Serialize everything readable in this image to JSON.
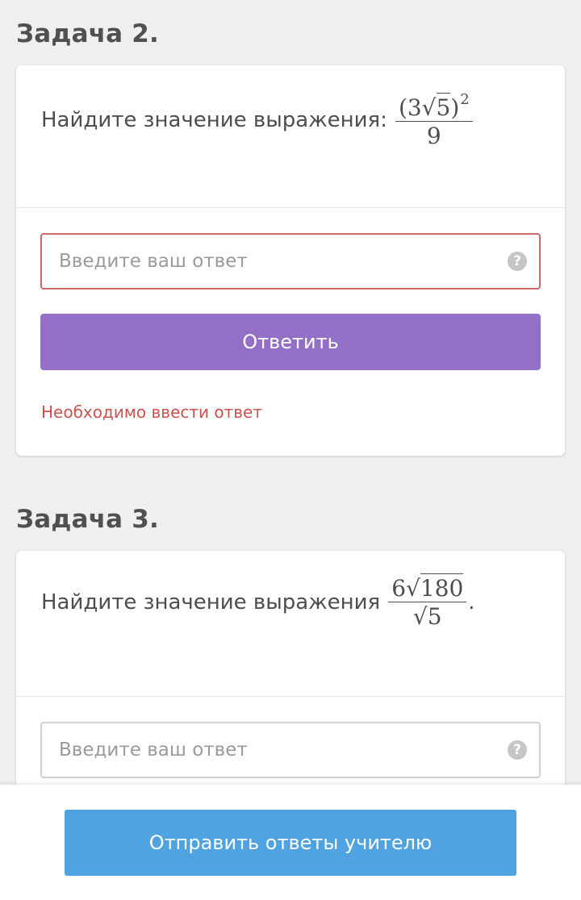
{
  "task2": {
    "title": "Задача 2.",
    "question_text": "Найдите значение выражения:",
    "expr": {
      "num_open": "(3√",
      "num_radicand": "5",
      "num_close": ")",
      "num_power": "2",
      "den": "9"
    },
    "answer_placeholder": "Введите ваш ответ",
    "help_icon": "?",
    "submit_label": "Ответить",
    "error_text": "Необходимо ввести ответ"
  },
  "task3": {
    "title": "Задача 3.",
    "question_text": "Найдите значение выражения",
    "expr": {
      "num_coef": "6√",
      "num_radicand": "180",
      "den_root": "√",
      "den_radicand": "5",
      "trailing": "."
    },
    "answer_placeholder": "Введите ваш ответ",
    "help_icon": "?"
  },
  "footer": {
    "send_label": "Отправить ответы учителю"
  },
  "colors": {
    "background": "#efefef",
    "submit_button": "#9370c6",
    "send_button": "#4ea3e0",
    "error": "#c9534e"
  }
}
